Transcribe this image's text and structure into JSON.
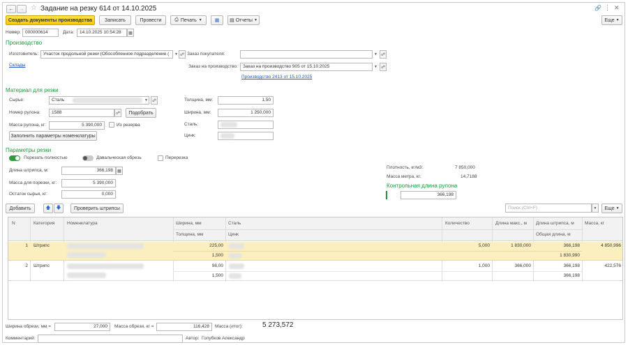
{
  "window": {
    "title": "Задание на резку 614 от 14.10.2025"
  },
  "toolbar": {
    "create_docs": "Создать документы производства",
    "save": "Записать",
    "post": "Провести",
    "print": "Печать",
    "reports": "Отчеты",
    "more": "Еще"
  },
  "header": {
    "number_label": "Номер:",
    "number": "000000614",
    "date_label": "Дата:",
    "date": "14.10.2025 10:54:28"
  },
  "production": {
    "section": "Производство",
    "maker_label": "Изготовитель:",
    "maker": "Участок продольной резки (Обособленное подразделение (",
    "warehouses_link": "Склады",
    "customer_order_label": "Заказ покупателя:",
    "customer_order": "",
    "prod_order_label": "Заказ на производство:",
    "prod_order": "Заказ на производство 905 от 15.10.2025",
    "production_link": "Производство 2413 от 15.10.2025"
  },
  "material": {
    "section": "Материал для резки",
    "raw_label": "Сырье:",
    "raw": "Сталь",
    "roll_label": "Номер рулона:",
    "roll": "1588",
    "pick": "Подобрать",
    "mass_label": "Масса рулона, кг:",
    "mass": "5 390,000",
    "reserve": "Из резерва",
    "fill_params": "Заполнить параметры номенклатуры",
    "thickness_label": "Толщина, мм:",
    "thickness": "1,50",
    "width_label": "Ширина, мм:",
    "width": "1 250,000",
    "steel_label": "Сталь:",
    "zinc_label": "Цинк:"
  },
  "cut_params": {
    "section": "Параметры резки",
    "cut_all": "Порезать полностью",
    "tolling": "Давальческая обрезь",
    "recut": "Перерезка",
    "strip_len_label": "Длина штрипса, м:",
    "strip_len": "366,198",
    "cut_mass_label": "Масса для порезки, кг:",
    "cut_mass": "5 390,000",
    "remain_label": "Остаток сырья, кг:",
    "remain": "0,000",
    "density_label": "Плотность, кг/м3:",
    "density": "7 850,000",
    "meter_mass_label": "Масса метра, кг:",
    "meter_mass": "14,7188",
    "control_section": "Контрольная длина рулона",
    "control_len": "366,198"
  },
  "table_bar": {
    "add": "Добавить",
    "check": "Проверить штрипсы",
    "search_placeholder": "Поиск (Ctrl+F)",
    "more": "Еще"
  },
  "table": {
    "headers": {
      "n": "N",
      "category": "Категория",
      "item": "Номенклатура",
      "width": "Ширина, мм",
      "thickness": "Толщина, мм",
      "steel": "Сталь",
      "zinc": "Цинк",
      "qty": "Количество",
      "max_len": "Длина макс., м",
      "strip_len": "Длина штрипса, м",
      "total_len": "Общая длина, м",
      "mass": "Масса, кг"
    },
    "rows": [
      {
        "n": "1",
        "category": "Штрипс",
        "width": "225,00",
        "thickness": "1,500",
        "qty": "5,000",
        "max_len": "1 830,000",
        "strip_len": "366,198",
        "total_len": "1 830,990",
        "mass": "4 850,996"
      },
      {
        "n": "2",
        "category": "Штрипс",
        "width": "98,00",
        "thickness": "1,500",
        "qty": "1,000",
        "max_len": "366,000",
        "strip_len": "366,198",
        "total_len": "366,198",
        "mass": "422,576"
      }
    ]
  },
  "footer": {
    "trim_width_label": "Ширина обрези, мм =",
    "trim_width": "27,000",
    "trim_mass_label": "Масса обрези, кг =",
    "trim_mass": "116,428",
    "total_mass_label": "Масса (итог):",
    "total_mass": "5 273,572",
    "comment_label": "Комментарий:",
    "comment": "",
    "author_label": "Автор:",
    "author": "Голубков Александр"
  },
  "colors": {
    "accent_green": "#1a9a3a",
    "primary_yellow": "#f5c800",
    "selected_row": "#fbefbf",
    "link_blue": "#1d56c5"
  }
}
